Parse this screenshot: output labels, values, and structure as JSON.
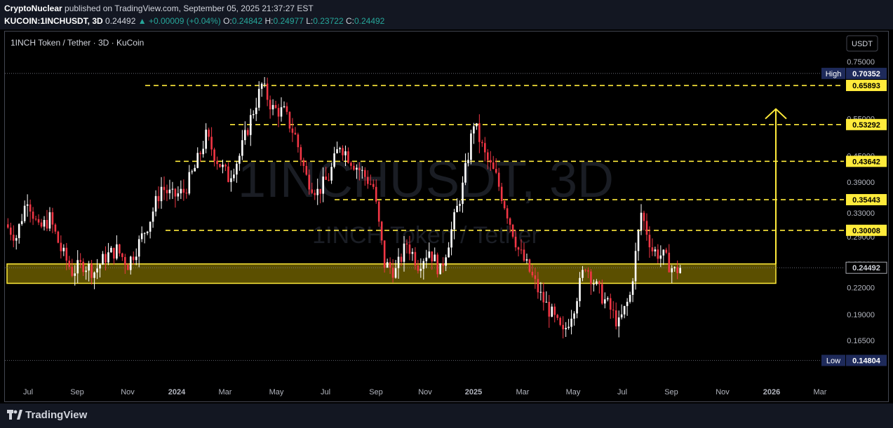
{
  "header": {
    "author": "CryptoNuclear",
    "published_text": "published on TradingView.com, September 05, 2025 21:37:27 EST",
    "symbol_full": "KUCOIN:1INCHUSDT, 3D",
    "last_price": "0.24492",
    "change": "▲ +0.00009 (+0.04%)",
    "open_label": "O:",
    "open": "0.24842",
    "high_label": "H:",
    "high": "0.24977",
    "low_label": "L:",
    "low": "0.23722",
    "close_label": "C:",
    "close": "0.24492"
  },
  "legend": "1INCH Token / Tether · 3D · KuCoin",
  "currency_button": "USDT",
  "watermark": {
    "line1": "1INCHUSDT, 3D",
    "line2": "1INCH Token / Tether"
  },
  "footer": {
    "brand": "TradingView"
  },
  "colors": {
    "up": "#ffffff",
    "down": "#f23645",
    "level": "#ffeb3b",
    "zone_fill": "#6b5d00",
    "panel": "#131722"
  },
  "chart_data": {
    "type": "candlestick",
    "scale": "log",
    "price_axis_ticks": [
      0.75,
      0.55,
      0.45,
      0.39,
      0.33,
      0.29,
      0.25,
      0.22,
      0.19,
      0.165
    ],
    "time_axis_ticks": [
      "Jul",
      "Sep",
      "Nov",
      "2024",
      "Mar",
      "May",
      "Jul",
      "Sep",
      "Nov",
      "2025",
      "Mar",
      "May",
      "Jul",
      "Sep",
      "Nov",
      "2026",
      "Mar"
    ],
    "high_marker": {
      "label": "High",
      "value": "0.70352"
    },
    "low_marker": {
      "label": "Low",
      "value": "0.14804"
    },
    "last_price_label": "0.24492",
    "resistance_levels": [
      "0.65893",
      "0.53292",
      "0.43642",
      "0.35443",
      "0.30008"
    ],
    "support_zone": [
      0.225,
      0.25
    ],
    "target_arrow": {
      "from": 0.25,
      "to": 0.58
    },
    "close_path": [
      [
        0,
        0.31
      ],
      [
        4,
        0.29
      ],
      [
        8,
        0.36
      ],
      [
        12,
        0.3
      ],
      [
        16,
        0.32
      ],
      [
        20,
        0.27
      ],
      [
        24,
        0.24
      ],
      [
        28,
        0.25
      ],
      [
        32,
        0.24
      ],
      [
        36,
        0.26
      ],
      [
        40,
        0.27
      ],
      [
        44,
        0.25
      ],
      [
        48,
        0.28
      ],
      [
        52,
        0.32
      ],
      [
        56,
        0.38
      ],
      [
        60,
        0.36
      ],
      [
        64,
        0.37
      ],
      [
        68,
        0.42
      ],
      [
        72,
        0.5
      ],
      [
        76,
        0.44
      ],
      [
        80,
        0.4
      ],
      [
        84,
        0.45
      ],
      [
        88,
        0.55
      ],
      [
        92,
        0.66
      ],
      [
        96,
        0.58
      ],
      [
        100,
        0.57
      ],
      [
        104,
        0.5
      ],
      [
        108,
        0.4
      ],
      [
        112,
        0.37
      ],
      [
        116,
        0.4
      ],
      [
        120,
        0.48
      ],
      [
        124,
        0.44
      ],
      [
        128,
        0.41
      ],
      [
        132,
        0.38
      ],
      [
        136,
        0.25
      ],
      [
        140,
        0.24
      ],
      [
        144,
        0.28
      ],
      [
        148,
        0.25
      ],
      [
        152,
        0.27
      ],
      [
        156,
        0.24
      ],
      [
        160,
        0.3
      ],
      [
        164,
        0.38
      ],
      [
        168,
        0.54
      ],
      [
        172,
        0.45
      ],
      [
        176,
        0.4
      ],
      [
        180,
        0.33
      ],
      [
        184,
        0.27
      ],
      [
        188,
        0.24
      ],
      [
        192,
        0.21
      ],
      [
        196,
        0.19
      ],
      [
        200,
        0.17
      ],
      [
        204,
        0.2
      ],
      [
        208,
        0.25
      ],
      [
        212,
        0.22
      ],
      [
        216,
        0.2
      ],
      [
        220,
        0.18
      ],
      [
        224,
        0.21
      ],
      [
        228,
        0.33
      ],
      [
        232,
        0.27
      ],
      [
        236,
        0.26
      ],
      [
        240,
        0.24
      ],
      [
        242,
        0.2449
      ]
    ],
    "last_index": 242,
    "index_axis_max": 300
  }
}
